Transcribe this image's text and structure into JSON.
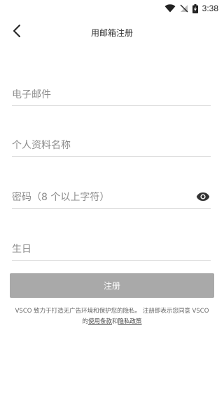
{
  "status_bar": {
    "time": "3:38",
    "icons": [
      "wifi-icon",
      "no-signal-icon",
      "battery-charging-icon"
    ]
  },
  "header": {
    "title": "用邮箱注册",
    "back_icon": "chevron-left-icon"
  },
  "form": {
    "email_placeholder": "电子邮件",
    "profile_name_placeholder": "个人资料名称",
    "password_placeholder": "密码（8 个以上字符）",
    "password_toggle_icon": "eye-icon",
    "birthday_placeholder": "生日"
  },
  "signup_button": "注册",
  "terms": {
    "text_line1": "VSCO 致力于打造无广告环境和保护您的隐私。 注册即表示您同意 VSCO",
    "text_prefix": "的",
    "terms_link": "使用条款",
    "and": "和",
    "privacy_link": "隐私政策"
  },
  "colors": {
    "button_bg": "#a9a9a9",
    "divider": "#d8d8d8",
    "placeholder": "#8c8c8c"
  }
}
